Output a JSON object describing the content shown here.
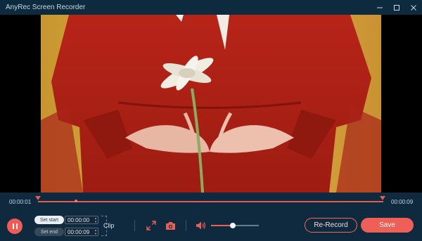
{
  "window": {
    "title": "AnyRec Screen Recorder",
    "controls": [
      "minimize-icon",
      "restore-icon",
      "close-icon"
    ]
  },
  "timeline": {
    "start_time": "00:00:01",
    "end_time": "00:00:09",
    "accent_color": "#e35d4e"
  },
  "clip": {
    "set_start_label": "Set start",
    "set_end_label": "Set end",
    "start_value": "00:00:00",
    "end_value": "00:00:09",
    "clip_label": "Clip"
  },
  "toolbar": {
    "pause_icon": "pause-icon",
    "fullscreen_icon": "expand-icon",
    "snapshot_icon": "camera-icon",
    "volume_icon": "speaker-icon",
    "volume_level": 0.45
  },
  "actions": {
    "rerecord_label": "Re-Record",
    "save_label": "Save",
    "save_color": "#f05f57"
  }
}
